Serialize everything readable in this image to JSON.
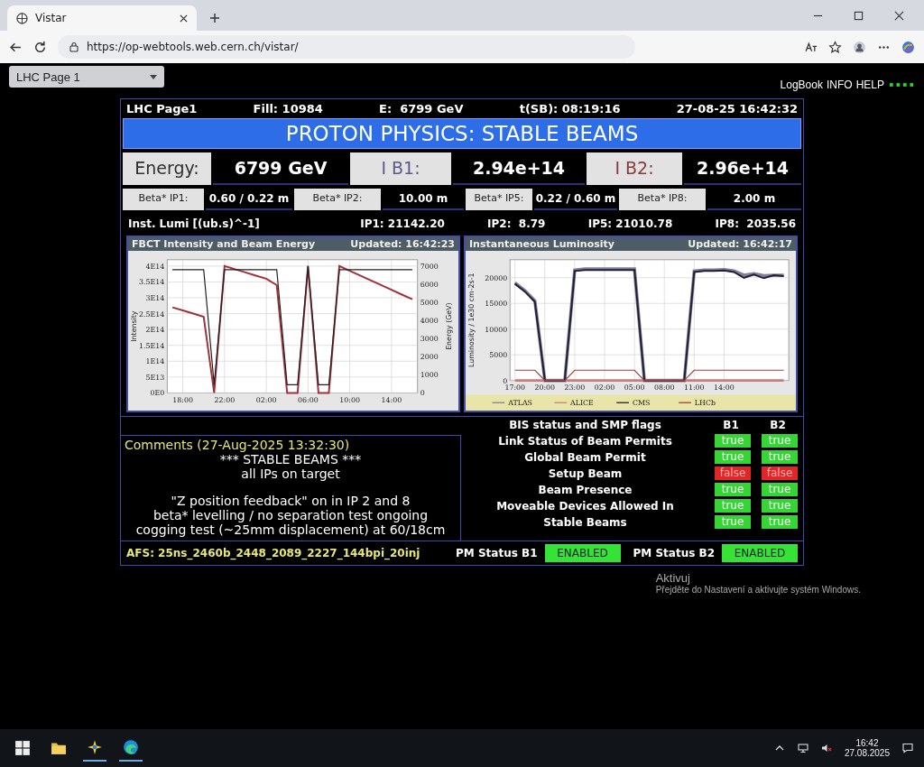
{
  "browser": {
    "tab_title": "Vistar",
    "url": "https://op-webtools.web.cern.ch/vistar/"
  },
  "page_select": {
    "value": "LHC Page 1"
  },
  "top_links": [
    "LogBook",
    "INFO",
    "HELP"
  ],
  "header": {
    "page": "LHC Page1",
    "fill": "Fill: 10984",
    "energy": "E:  6799 GeV",
    "tsb": "t(SB): 08:19:16",
    "datetime": "27-08-25 16:42:32"
  },
  "banner": "PROTON PHYSICS: STABLE BEAMS",
  "main_values": [
    {
      "label": "Energy:",
      "value": "6799 GeV",
      "color": "#303030"
    },
    {
      "label": "I B1:",
      "value": "2.94e+14",
      "color": "#5a5a8a"
    },
    {
      "label": "I B2:",
      "value": "2.96e+14",
      "color": "#8a3a3a"
    }
  ],
  "beta_star": [
    {
      "label": "Beta* IP1:",
      "value": "0.60 / 0.22 m"
    },
    {
      "label": "Beta* IP2:",
      "value": "10.00 m"
    },
    {
      "label": "Beta* IP5:",
      "value": "0.22 / 0.60 m"
    },
    {
      "label": "Beta* IP8:",
      "value": "2.00 m"
    }
  ],
  "lumi": {
    "label": "Inst. Lumi [(ub.s)^-1]",
    "values": [
      "IP1: 21142.20",
      "IP2:  8.79",
      "IP5: 21010.78",
      "IP8:  2035.56"
    ]
  },
  "charts": [
    {
      "title": "FBCT Intensity and Beam Energy",
      "updated": "Updated: 16:42:23",
      "chart_data": {
        "type": "line",
        "grid": true,
        "ylabel": "Intensity",
        "y2label": "Energy (GeV)",
        "ylim": [
          0,
          420000000000000.0
        ],
        "y2lim": [
          0,
          7350
        ],
        "categories": [
          null,
          "18:00",
          null,
          null,
          null,
          "22:00",
          null,
          null,
          null,
          "02:00",
          null,
          null,
          null,
          "06:00",
          null,
          null,
          null,
          "10:00",
          null,
          null,
          null,
          "14:00",
          null,
          null
        ],
        "yticks": [
          {
            "value": 0,
            "label": "0E0"
          },
          {
            "value": 50000000000000.0,
            "label": "5E13"
          },
          {
            "value": 100000000000000.0,
            "label": "1E14"
          },
          {
            "value": 150000000000000.0,
            "label": "1.5E14"
          },
          {
            "value": 200000000000000.0,
            "label": "2E14"
          },
          {
            "value": 250000000000000.0,
            "label": "2.5E14"
          },
          {
            "value": 300000000000000.0,
            "label": "3E14"
          },
          {
            "value": 350000000000000.0,
            "label": "3.5E14"
          },
          {
            "value": 400000000000000.0,
            "label": "4E14"
          }
        ],
        "y2ticks": [
          0,
          1000,
          2000,
          3000,
          4000,
          5000,
          6000,
          7000
        ],
        "series": [
          {
            "color": "#a0303a",
            "values": [
              270000000000000.0,
              260000000000000.0,
              250000000000000.0,
              240000000000000.0,
              0,
              400000000000000.0,
              390000000000000.0,
              380000000000000.0,
              370000000000000.0,
              360000000000000.0,
              340000000000000.0,
              0,
              0,
              400000000000000.0,
              0,
              0,
              400000000000000.0,
              385000000000000.0,
              370000000000000.0,
              355000000000000.0,
              340000000000000.0,
              325000000000000.0,
              310000000000000.0,
              295000000000000.0
            ]
          },
          {
            "color": "#202020",
            "axis": "y2",
            "values": [
              6800,
              6800,
              6800,
              6800,
              450,
              6800,
              6800,
              6800,
              6800,
              6800,
              6800,
              450,
              450,
              7000,
              450,
              450,
              6800,
              6800,
              6800,
              6800,
              6800,
              6800,
              6800,
              6800
            ]
          }
        ]
      }
    },
    {
      "title": "Instantaneous Luminosity",
      "updated": "Updated: 16:42:17",
      "chart_data": {
        "type": "line",
        "grid": true,
        "legend": "bottom",
        "ylabel": "Luminosity / 1e30 cm-2s-1",
        "ylim": [
          0,
          23500
        ],
        "categories": [
          "17:00",
          null,
          null,
          "20:00",
          null,
          null,
          "23:00",
          null,
          null,
          "02:00",
          null,
          null,
          "05:00",
          null,
          null,
          "08:00",
          null,
          null,
          "11:00",
          null,
          null,
          "14:00",
          null,
          null,
          null,
          null,
          null,
          null
        ],
        "yticks": [
          0,
          5000,
          10000,
          15000,
          20000
        ],
        "series": [
          {
            "name": "ATLAS",
            "color": "#7f7f9f",
            "values": [
              19000,
              17500,
              15500,
              0,
              0,
              0,
              21500,
              21700,
              21700,
              21700,
              21700,
              21700,
              21700,
              0,
              0,
              0,
              0,
              0,
              21300,
              21500,
              21500,
              21600,
              21300,
              20500,
              20800,
              20400,
              20500,
              20500
            ]
          },
          {
            "name": "ALICE",
            "color": "#c08080",
            "values": [
              0,
              0,
              0,
              0,
              0,
              0,
              0,
              0,
              0,
              0,
              0,
              0,
              0,
              0,
              0,
              0,
              0,
              0,
              0,
              0,
              0,
              0,
              0,
              0,
              0,
              0,
              0,
              0
            ]
          },
          {
            "name": "CMS",
            "color": "#202030",
            "values": [
              18800,
              17300,
              15300,
              0,
              0,
              0,
              21300,
              21500,
              21500,
              21500,
              21500,
              21500,
              21500,
              0,
              0,
              0,
              0,
              0,
              21100,
              21300,
              21300,
              21400,
              21100,
              20000,
              20600,
              19900,
              20500,
              20300
            ]
          },
          {
            "name": "LHCb",
            "color": "#a04040",
            "values": [
              2000,
              2000,
              2000,
              0,
              0,
              0,
              2000,
              2000,
              2000,
              2000,
              2000,
              2000,
              2000,
              0,
              0,
              0,
              0,
              0,
              2000,
              2000,
              2000,
              2000,
              2000,
              2000,
              2000,
              2000,
              2000,
              2000
            ]
          }
        ]
      }
    }
  ],
  "comments": {
    "title": "Comments (27-Aug-2025 13:32:30)",
    "paragraphs": [
      [
        "*** STABLE BEAMS ***",
        "all IPs on target"
      ],
      [
        "\"Z position feedback\" on in IP 2 and 8",
        "beta* levelling / no separation test ongoing",
        "cogging test (~25mm displacement) at 60/18cm"
      ]
    ]
  },
  "flags": {
    "title": "BIS status and SMP flags",
    "columns": [
      "B1",
      "B2"
    ],
    "rows": [
      {
        "name": "Link Status of Beam Permits",
        "values": [
          {
            "text": "true",
            "on": true
          },
          {
            "text": "true",
            "on": true
          }
        ]
      },
      {
        "name": "Global Beam Permit",
        "values": [
          {
            "text": "true",
            "on": true
          },
          {
            "text": "true",
            "on": true
          }
        ]
      },
      {
        "name": "Setup Beam",
        "values": [
          {
            "text": "false",
            "on": false
          },
          {
            "text": "false",
            "on": false
          }
        ]
      },
      {
        "name": "Beam Presence",
        "values": [
          {
            "text": "true",
            "on": true
          },
          {
            "text": "true",
            "on": true
          }
        ]
      },
      {
        "name": "Moveable Devices Allowed In",
        "values": [
          {
            "text": "true",
            "on": true
          },
          {
            "text": "true",
            "on": true
          }
        ]
      },
      {
        "name": "Stable Beams",
        "values": [
          {
            "text": "true",
            "on": true
          },
          {
            "text": "true",
            "on": true
          }
        ]
      }
    ]
  },
  "afs": "AFS: 25ns_2460b_2448_2089_2227_144bpi_20inj",
  "pm_status": [
    {
      "label": "PM Status B1",
      "value": "ENABLED",
      "enabled": true
    },
    {
      "label": "PM Status B2",
      "value": "ENABLED",
      "enabled": true
    }
  ],
  "activation": {
    "title": "Aktivuj",
    "text": "Přejděte do Nastavení a aktivujte systém Windows."
  },
  "taskbar": {
    "time": "16:42",
    "date": "27.08.2025"
  }
}
